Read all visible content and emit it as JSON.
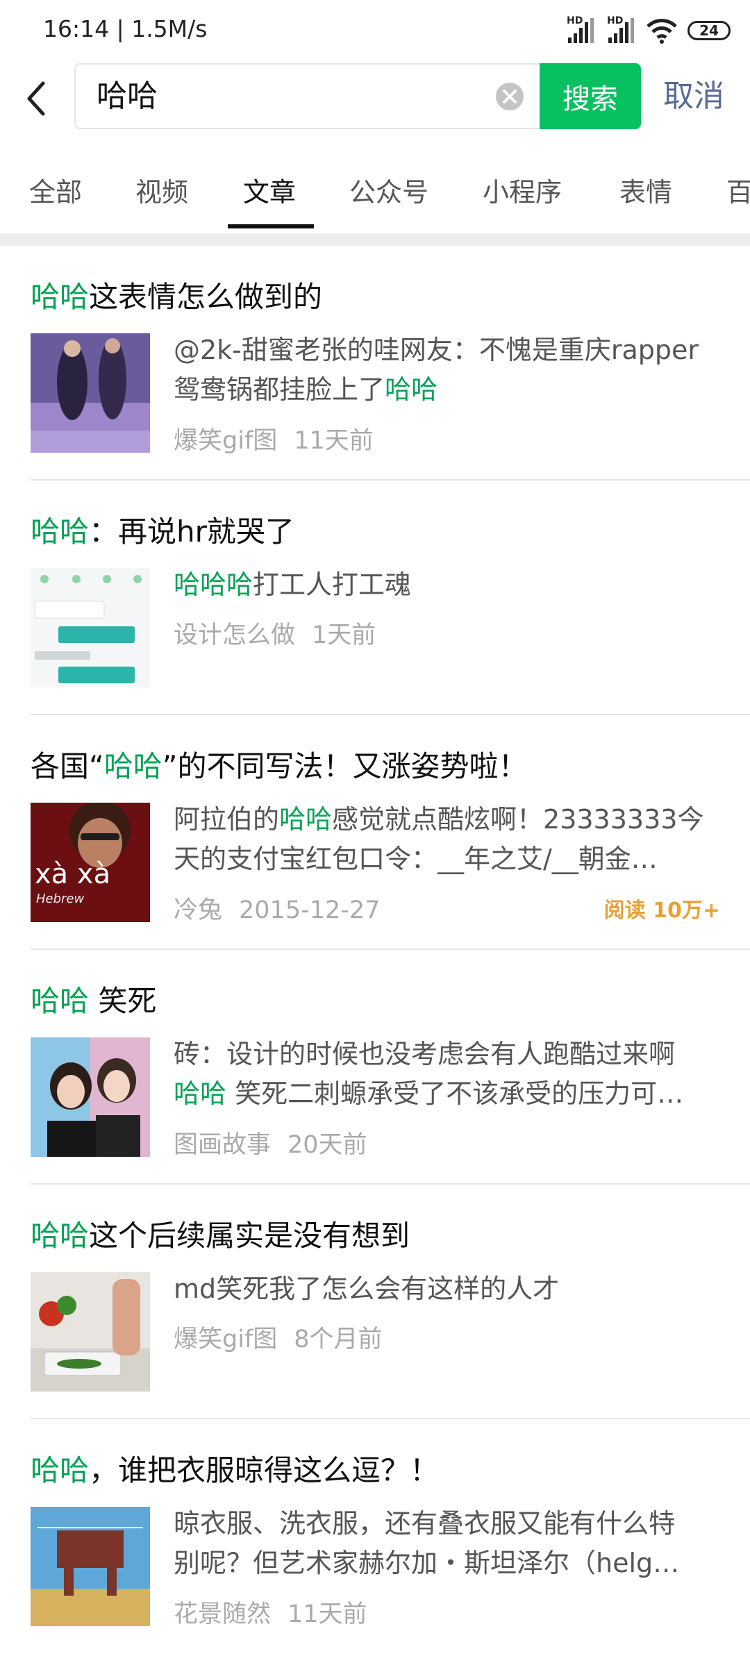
{
  "status": {
    "time": "16:14 | 1.5M/s",
    "signal1": "HD",
    "signal2": "HD",
    "battery": "24"
  },
  "search": {
    "query": "哈哈",
    "button": "搜索",
    "cancel": "取消"
  },
  "tabs": [
    "全部",
    "视频",
    "文章",
    "公众号",
    "小程序",
    "表情",
    "百"
  ],
  "active_tab": "文章",
  "colors": {
    "accent": "#07c160",
    "highlight": "#07a255",
    "link": "#576b95",
    "read_count": "#e8a134"
  },
  "results": [
    {
      "title": {
        "hl": "哈哈",
        "rest": "这表情怎么做到的"
      },
      "summary": {
        "l1": "@2k-甜蜜老张的哇网友：不愧是重庆rapper",
        "l2_pre": "鸳鸯锅都挂脸上了",
        "l2_hl": "哈哈"
      },
      "source": "爆笑gif图",
      "time": "11天前"
    },
    {
      "title": {
        "hl": "哈哈",
        "rest": "：再说hr就哭了"
      },
      "summary": {
        "hl": "哈哈哈",
        "rest": "打工人打工魂"
      },
      "source": "设计怎么做",
      "time": "1天前"
    },
    {
      "title": {
        "pre": "各国“",
        "hl": "哈哈",
        "post": "”的不同写法！又涨姿势啦！"
      },
      "summary": {
        "l1_pre": "阿拉伯的",
        "l1_hl": "哈哈",
        "l1_post": "感觉就点酷炫啊！23333333今",
        "l2": "天的支付宝红包口令：__年之艾/__朝金…"
      },
      "thumb_text": "xà xà",
      "thumb_sub": "Hebrew",
      "source": "冷兔",
      "time": "2015-12-27",
      "reads": "阅读 10万+"
    },
    {
      "title": {
        "hl": "哈哈",
        "rest": " 笑死"
      },
      "summary": {
        "l1": "砖：设计的时候也没考虑会有人跑酷过来啊",
        "l2_hl": "哈哈",
        "l2_rest": " 笑死二刺螈承受了不该承受的压力可…"
      },
      "source": "图画故事",
      "time": "20天前"
    },
    {
      "title": {
        "hl": "哈哈",
        "rest": "这个后续属实是没有想到"
      },
      "summary": {
        "l1": "md笑死我了怎么会有这样的人才"
      },
      "source": "爆笑gif图",
      "time": "8个月前"
    },
    {
      "title": {
        "hl": "哈哈",
        "rest": "，谁把衣服晾得这么逗？！"
      },
      "summary": {
        "l1": "晾衣服、洗衣服，还有叠衣服又能有什么特",
        "l2": "别呢？但艺术家赫尔加・斯坦泽尔（helg…"
      },
      "source": "花景随然",
      "time": "11天前"
    }
  ]
}
